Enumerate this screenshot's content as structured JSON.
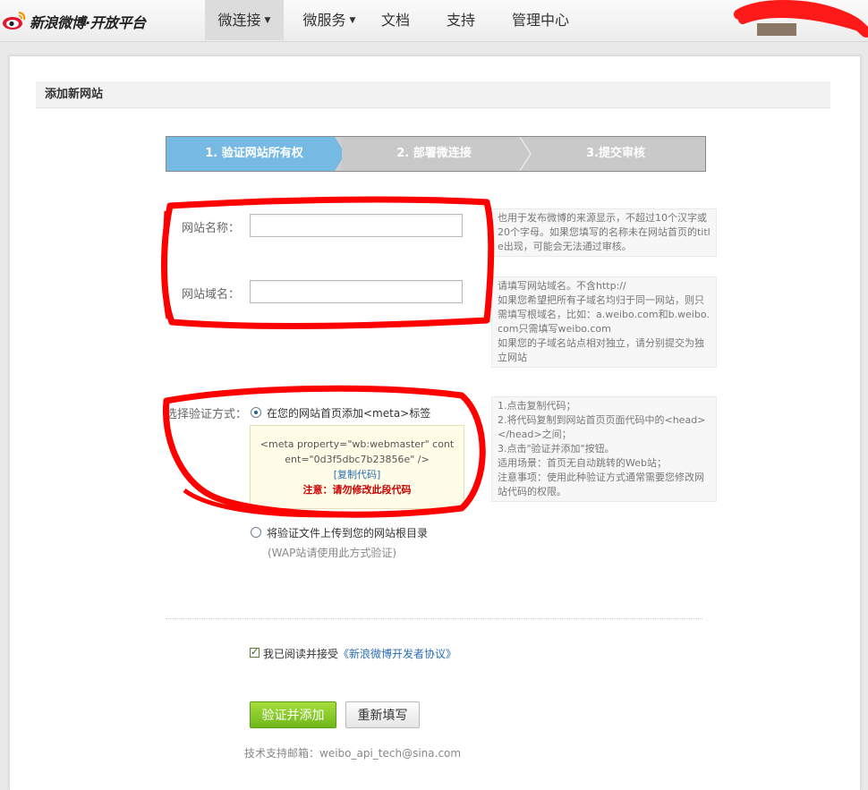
{
  "header": {
    "logo_text": "新浪微博·开放平台",
    "nav": [
      {
        "label": "微连接",
        "has_caret": true
      },
      {
        "label": "微服务",
        "has_caret": true
      },
      {
        "label": "文档",
        "has_caret": false
      },
      {
        "label": "支持",
        "has_caret": false
      },
      {
        "label": "管理中心",
        "has_caret": false
      }
    ],
    "caret_icon": "chevron-down-icon"
  },
  "page": {
    "title": "添加新网站",
    "steps": [
      "1. 验证网站所有权",
      "2. 部署微连接",
      "3.提交审核"
    ]
  },
  "form": {
    "site_name": {
      "label": "网站名称：",
      "value": "",
      "tip": "也用于发布微博的来源显示，不超过10个汉字或20个字母。如果您填写的名称未在网站首页的title出现，可能会无法通过审核。"
    },
    "site_domain": {
      "label": "网站域名：",
      "value": "",
      "tip_lines": [
        "请填写网站域名。不含http://",
        "如果您希望把所有子域名均归于同一网站，则只需填写根域名，比如：a.weibo.com和b.weibo.com只需填写weibo.com",
        "如果您的子域名站点相对独立，请分别提交为独立网站"
      ]
    },
    "verify": {
      "label": "选择验证方式：",
      "option_meta": "在您的网站首页添加<meta>标签",
      "meta_code": "<meta property=\"wb:webmaster\" content=\"0d3f5dbc7b23856e\" />",
      "copy_link": "[复制代码]",
      "warning": "注意：请勿修改此段代码",
      "option_file": "将验证文件上传到您的网站根目录",
      "option_file_note": "(WAP站请使用此方式验证)",
      "selected": "meta",
      "tip_lines": [
        "1.点击复制代码；",
        "2.将代码复制到网站首页页面代码中的<head></head>之间；",
        "3.点击\"验证并添加\"按钮。",
        "适用场景：首页无自动跳转的Web站；",
        "注意事项：使用此种验证方式通常需要您修改网站代码的权限。"
      ]
    },
    "agree": {
      "checked": true,
      "text": "我已阅读并接受",
      "link": "《新浪微博开发者协议》"
    },
    "submit_label": "验证并添加",
    "reset_label": "重新填写",
    "support_email": "技术支持邮箱：weibo_api_tech@sina.com"
  },
  "colors": {
    "annotation_red": "#ff0000",
    "step_active": "#76b9e3",
    "primary_button": "#7cc21f",
    "link": "#2a6db5"
  }
}
